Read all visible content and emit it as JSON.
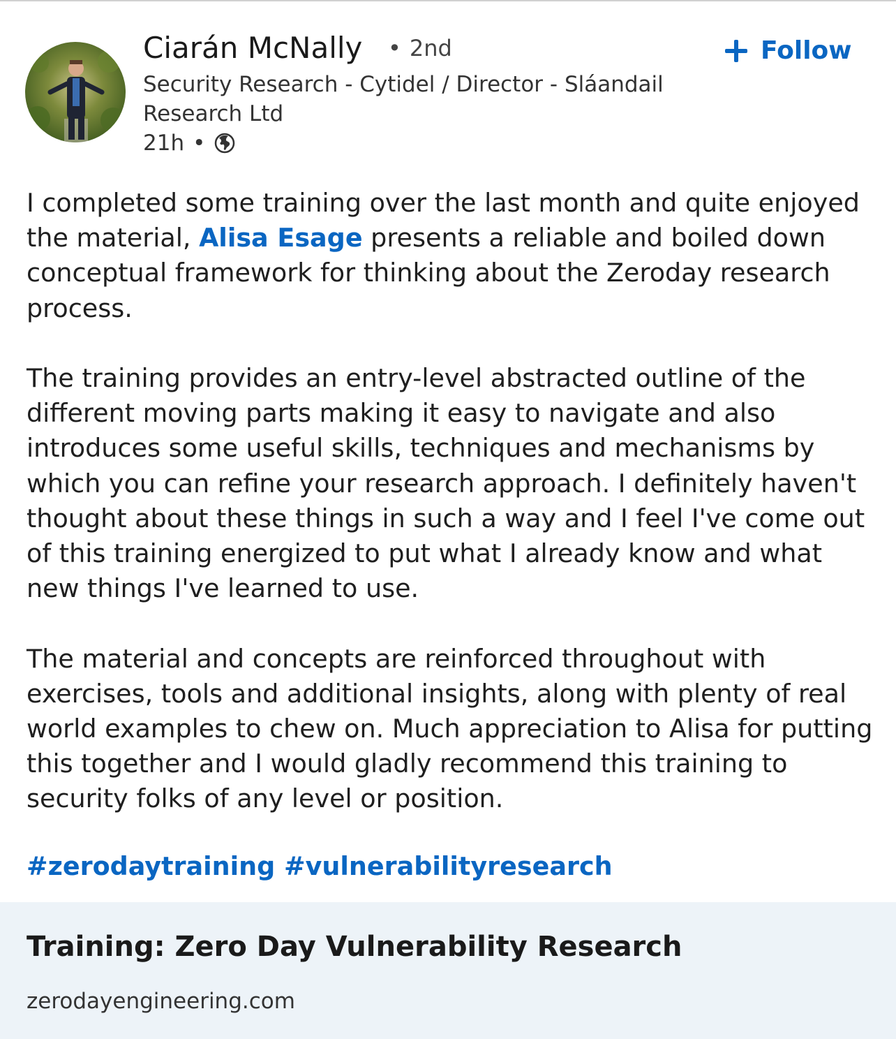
{
  "author": {
    "name": "Ciarán McNally",
    "degree": "2nd",
    "degree_separator": "•",
    "headline": "Security Research - Cytidel / Director - Sláandail Research Ltd",
    "time": "21h",
    "time_separator": "•"
  },
  "follow": {
    "label": "Follow"
  },
  "post": {
    "p1_before": "I completed some training over the last month and quite enjoyed the material, ",
    "p1_mention": "Alisa Esage",
    "p1_after": " presents a reliable and boiled down conceptual framework for thinking about the Zeroday research process.",
    "p2": "The training provides an entry-level abstracted outline of the different moving parts making it easy to navigate and also introduces some useful skills, techniques and mechanisms by which you can refine your research approach. I definitely haven't thought about these things in such a way and I feel I've come out of this training energized to put what I already know and what new things I've learned to use.",
    "p3": "The material and concepts are reinforced throughout with exercises, tools and additional insights, along with plenty of real world examples to chew on. Much appreciation to Alisa for putting this together and I would gladly recommend this training to security folks of any level or position.",
    "hashtags": [
      "#zerodaytraining",
      "#vulnerabilityresearch"
    ]
  },
  "link_card": {
    "title": "Training: Zero Day Vulnerability Research",
    "domain": "zerodayengineering.com"
  },
  "colors": {
    "link_blue": "#0a66c2",
    "card_bg": "#edf3f8"
  }
}
